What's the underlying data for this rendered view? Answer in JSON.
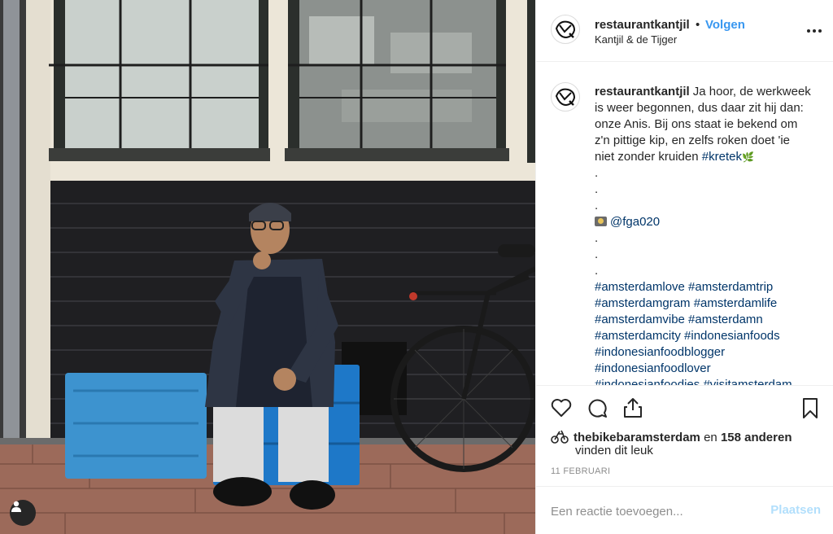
{
  "post": {
    "username": "restaurantkantjil",
    "separator": "•",
    "follow_label": "Volgen",
    "location": "Kantjil & de Tijger"
  },
  "caption": {
    "username": "restaurantkantjil",
    "text_lines": [
      "Ja hoor, de werkweek",
      "is weer begonnen, dus daar zit hij dan:",
      "onze Anis. Bij ons staat ie bekend om",
      "z'n pittige kip, en zelfs roken doet 'ie",
      "niet zonder kruiden"
    ],
    "inline_hashtag": "#kretek",
    "leaf_emoji": "🌿",
    "dots": [
      ".",
      ".",
      "."
    ],
    "mention": "@fga020",
    "dots2": [
      ".",
      ".",
      "."
    ],
    "hashtag_lines": [
      "#amsterdamlove #amsterdamtrip",
      "#amsterdamgram #amsterdamlife",
      "#amsterdamvibe #amsterdamn",
      "#amsterdamcity #indonesianfoods",
      "#indonesianfoodblogger",
      "#indonesianfoodlover",
      "#indonesianfoodies #visitamsterdam"
    ]
  },
  "actions": {
    "like_icon": "heart-icon",
    "comment_icon": "comment-icon",
    "share_icon": "share-icon",
    "save_icon": "bookmark-icon"
  },
  "likes": {
    "first_liker": "thebikebaramsterdam",
    "connector": "en",
    "others": "158 anderen",
    "suffix": "vinden dit leuk"
  },
  "date": "11 FEBRUARI",
  "comment_box": {
    "placeholder": "Een reactie toevoegen...",
    "post_label": "Plaatsen"
  },
  "colors": {
    "link_blue": "#3897f0",
    "hashtag_blue": "#003569",
    "post_disabled": "#b2dffc",
    "muted": "#8e8e8e"
  }
}
